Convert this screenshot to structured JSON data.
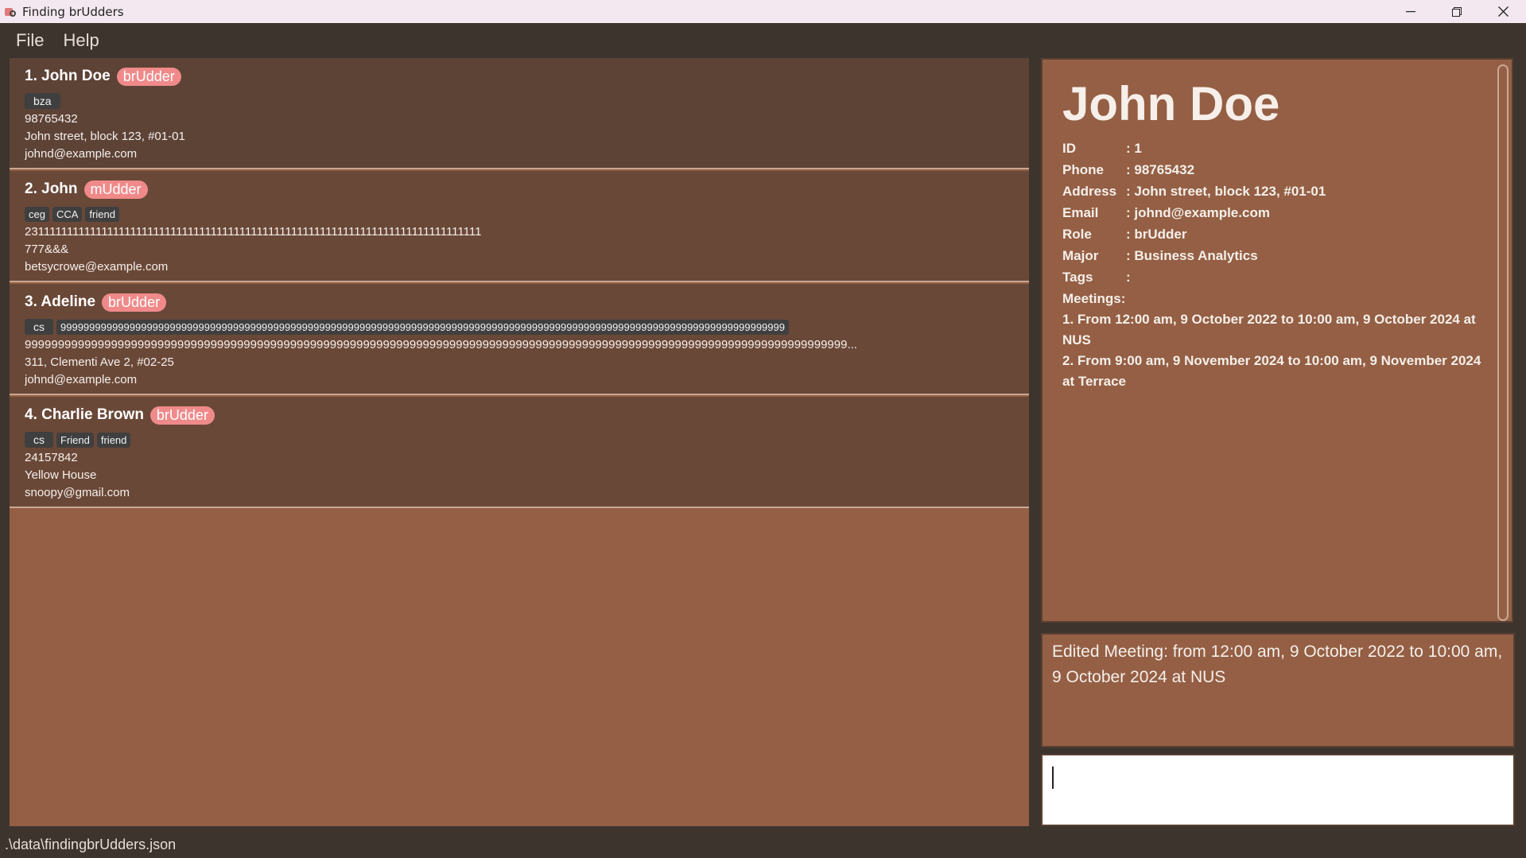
{
  "window": {
    "title": "Finding brUdders",
    "icons": {
      "minimize": "minimize-icon",
      "maximize": "restore-icon",
      "close": "close-icon"
    }
  },
  "menu": {
    "file": "File",
    "help": "Help"
  },
  "persons": [
    {
      "name": "1. John Doe",
      "role": "brUdder",
      "tags": [
        "bza"
      ],
      "phone": "98765432",
      "address": "John street, block 123, #01-01",
      "email": "johnd@example.com",
      "bg": "#5d4236"
    },
    {
      "name": "2. John",
      "role": "mUdder",
      "tags": [
        "ceg",
        "CCA",
        "friend"
      ],
      "phone": "2311111111111111111111111111111111111111111111111111111111111111111111111111111",
      "address": "777&&&",
      "email": "betsycrowe@example.com",
      "bg": "#6a4838"
    },
    {
      "name": "3. Adeline",
      "role": "brUdder",
      "tags": [
        "cs",
        "999999999999999999999999999999999999999999999999999999999999999999999999999999999999999999999999999999999999999999999999999999"
      ],
      "phone": "9999999999999999999999999999999999999999999999999999999999999999999999999999999999999999999999999999999999999999999999999999...",
      "address": "311, Clementi Ave 2, #02-25",
      "email": "johnd@example.com",
      "bg": "#6a4838"
    },
    {
      "name": "4. Charlie Brown",
      "role": "brUdder",
      "tags": [
        "cs",
        "Friend",
        "friend"
      ],
      "phone": "24157842",
      "address": "Yellow House",
      "email": "snoopy@gmail.com",
      "bg": "#6a4838"
    }
  ],
  "detail": {
    "title": "John Doe",
    "fields": [
      {
        "label": "ID",
        "value": ": 1"
      },
      {
        "label": "Phone",
        "value": ": 98765432"
      },
      {
        "label": "Address",
        "value": ": John street, block 123, #01-01"
      },
      {
        "label": "Email",
        "value": ": johnd@example.com"
      },
      {
        "label": "Role",
        "value": ": brUdder"
      },
      {
        "label": "Major",
        "value": ": Business Analytics"
      },
      {
        "label": "Tags",
        "value": ":"
      },
      {
        "label": "Meetings",
        "value": ":"
      }
    ],
    "meetings": [
      "1. From 12:00 am, 9 October 2022 to 10:00 am, 9 October 2024 at NUS",
      "2. From 9:00 am, 9 November 2024 to 10:00 am, 9 November 2024 at Terrace"
    ]
  },
  "result": {
    "text": "Edited Meeting: from 12:00 am, 9 October 2022 to 10:00 am, 9 October 2024 at NUS"
  },
  "command": {
    "value": ""
  },
  "status": {
    "path": ".\\data\\findingbrUdders.json"
  },
  "colors": {
    "panel_bg": "#945f44",
    "role_badge": "#f08a8a",
    "tag_bg": "#3f3f3f"
  }
}
